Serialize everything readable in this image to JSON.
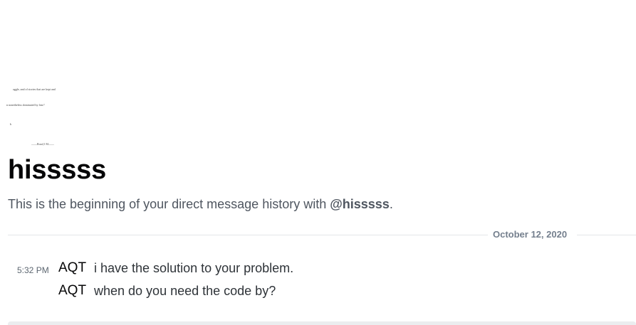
{
  "avatar_fragments": [
    "aggle, and of stories that are kept and",
    "n nonetheless dominated by fear?",
    "b",
    "——Rose(1 M——"
  ],
  "header": {
    "title": "hisssss",
    "intro_prefix": "This is the beginning of your direct message history with ",
    "intro_mention": "@hisssss",
    "intro_suffix": "."
  },
  "divider": {
    "date": "October 12, 2020"
  },
  "messages": [
    {
      "time": "5:32 PM",
      "author": "AQT",
      "text": "i have the solution to your problem."
    },
    {
      "time": "",
      "author": "AQT",
      "text": "when do you need the code by?"
    }
  ]
}
